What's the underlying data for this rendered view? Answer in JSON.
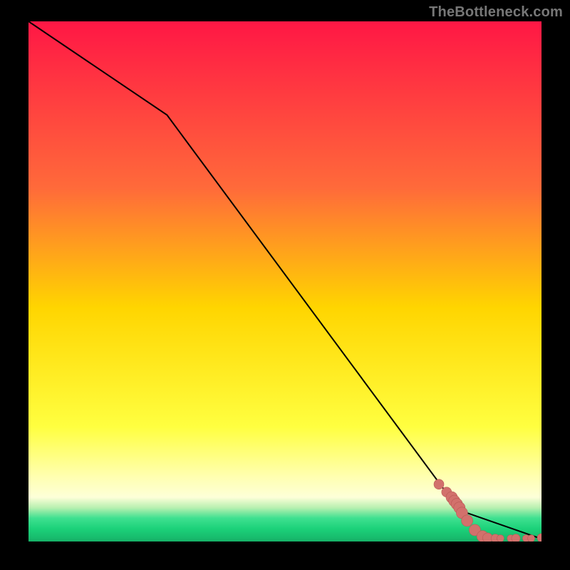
{
  "attribution": "TheBottleneck.com",
  "colors": {
    "line": "#000000",
    "marker_fill": "#d2716c",
    "marker_stroke": "#b95a55",
    "bg_top": "#ff1745",
    "bg_mid": "#ffd500",
    "bg_bottom_yellow": "#ffff78",
    "bg_green": "#1cd27a",
    "frame": "#000000"
  },
  "chart_data": {
    "type": "line",
    "title": "",
    "xlabel": "",
    "ylabel": "",
    "xlim": [
      0,
      100
    ],
    "ylim": [
      0,
      100
    ],
    "line": {
      "x": [
        0,
        27,
        84,
        100
      ],
      "y": [
        100,
        82,
        6,
        0.5
      ]
    },
    "series": [
      {
        "name": "markers",
        "x": [
          80,
          81.5,
          82.5,
          83,
          83.5,
          84,
          84.5,
          85.5,
          87,
          88.5,
          89.5,
          91,
          92,
          94,
          95,
          97,
          98,
          100
        ],
        "y": [
          11,
          9.5,
          8.5,
          7.8,
          7.2,
          6.5,
          5.5,
          4,
          2.2,
          1,
          0.7,
          0.6,
          0.6,
          0.6,
          0.6,
          0.6,
          0.6,
          0.7
        ],
        "r": [
          7,
          7,
          8,
          8,
          8,
          8,
          8,
          8,
          8,
          8,
          7,
          6,
          5,
          5,
          6,
          5,
          5,
          6
        ]
      }
    ],
    "gradient_stops": [
      {
        "offset": 0,
        "color": "#ff1745"
      },
      {
        "offset": 0.32,
        "color": "#ff6a3a"
      },
      {
        "offset": 0.55,
        "color": "#ffd500"
      },
      {
        "offset": 0.78,
        "color": "#ffff40"
      },
      {
        "offset": 0.875,
        "color": "#ffffb0"
      },
      {
        "offset": 0.915,
        "color": "#fdffd8"
      },
      {
        "offset": 0.935,
        "color": "#b8f0b0"
      },
      {
        "offset": 0.955,
        "color": "#3fe090"
      },
      {
        "offset": 0.975,
        "color": "#1cd27a"
      },
      {
        "offset": 1.0,
        "color": "#16b268"
      }
    ]
  }
}
